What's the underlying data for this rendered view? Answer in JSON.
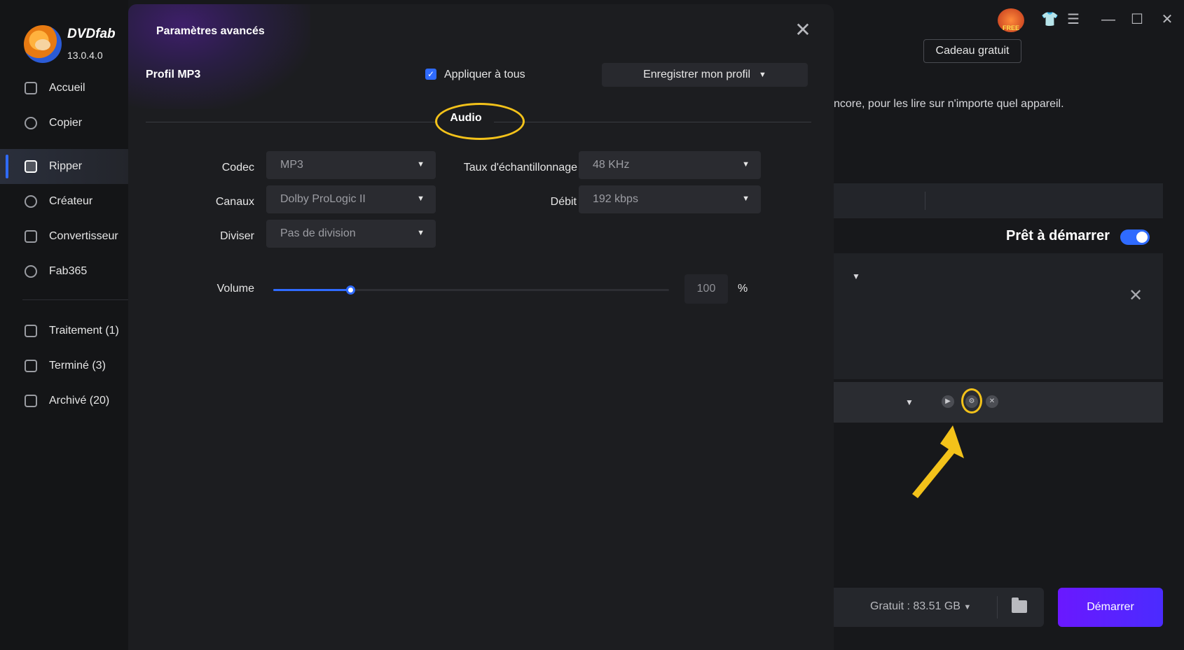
{
  "app": {
    "brand": "DVDfab",
    "version": "13.0.4.0"
  },
  "sidebar": {
    "items": [
      {
        "label": "Accueil"
      },
      {
        "label": "Copier"
      },
      {
        "label": "Ripper"
      },
      {
        "label": "Créateur"
      },
      {
        "label": "Convertisseur"
      },
      {
        "label": "Fab365"
      },
      {
        "label": "Traitement (1)"
      },
      {
        "label": "Terminé (3)"
      },
      {
        "label": "Archivé (20)"
      }
    ],
    "active_index": 2
  },
  "topbar": {
    "free_badge": "FREE",
    "gift_button": "Cadeau gratuit"
  },
  "background": {
    "description_text": "ncore, pour les lire sur n'importe quel appareil.",
    "ready_label": "Prêt à démarrer",
    "ready_toggle_on": true,
    "free_space": "Gratuit : 83.51 GB",
    "start_button": "Démarrer"
  },
  "modal": {
    "title": "Paramètres avancés",
    "profile_label": "Profil MP3",
    "apply_all_label": "Appliquer à tous",
    "apply_all_checked": true,
    "save_profile_label": "Enregistrer mon profil",
    "section_title": "Audio",
    "fields": {
      "codec": {
        "label": "Codec",
        "value": "MP3"
      },
      "channels": {
        "label": "Canaux",
        "value": "Dolby ProLogic II"
      },
      "split": {
        "label": "Diviser",
        "value": "Pas de division"
      },
      "sample_rate": {
        "label": "Taux d'échantillonnage",
        "value": "48 KHz"
      },
      "bitrate": {
        "label": "Débit",
        "value": "192 kbps"
      }
    },
    "volume": {
      "label": "Volume",
      "value": "100",
      "unit": "%",
      "slider_fraction": 0.195
    }
  },
  "colors": {
    "accent": "#2f6bff",
    "highlight": "#f3c21a",
    "start_button": "#6a18ff"
  }
}
